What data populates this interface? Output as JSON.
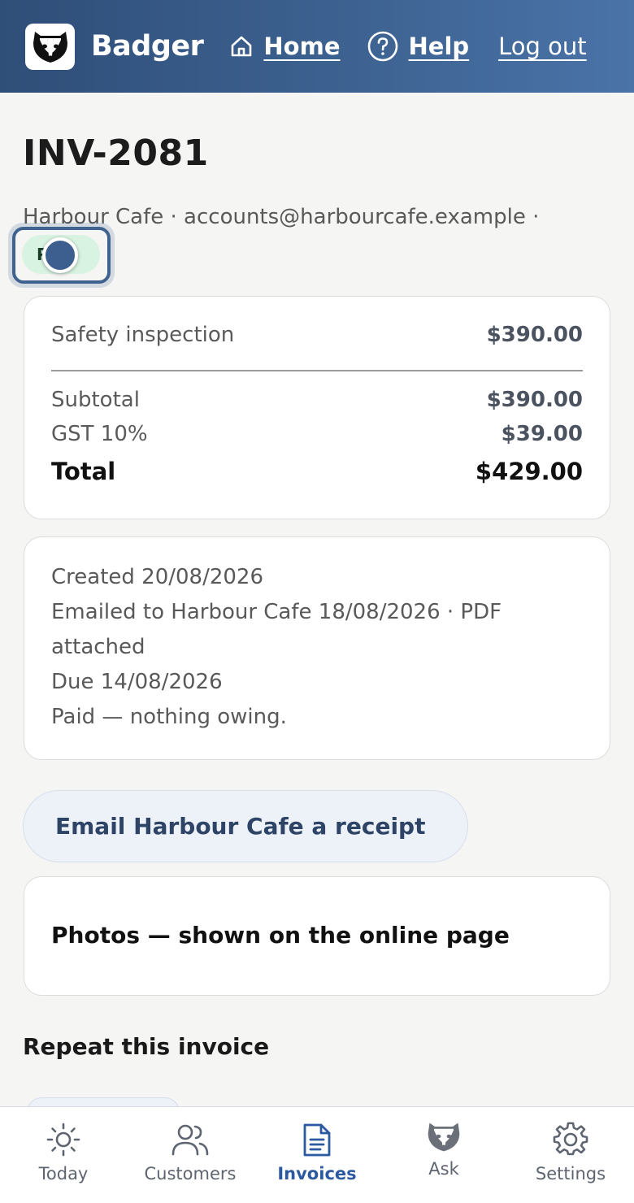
{
  "header": {
    "brand": "Badger",
    "nav": {
      "home_label": "Home",
      "help_label": "Help",
      "logout_label": "Log out"
    }
  },
  "invoice": {
    "number": "INV-2081",
    "meta_line": "Harbour Cafe · accounts@harbourcafe.example ·",
    "status_badge": "Paid"
  },
  "totals": {
    "line_items": [
      {
        "description": "Safety inspection",
        "amount": "$390.00"
      }
    ],
    "subtotal_label": "Subtotal",
    "subtotal_value": "$390.00",
    "tax_label": "GST 10%",
    "tax_value": "$39.00",
    "total_label": "Total",
    "total_value": "$429.00"
  },
  "history": {
    "created": "Created 20/08/2026",
    "emailed": "Emailed to Harbour Cafe 18/08/2026 · PDF attached",
    "due": "Due 14/08/2026",
    "paid": "Paid — nothing owing."
  },
  "actions": {
    "email_receipt_label": "Email Harbour Cafe a receipt"
  },
  "photos": {
    "title": "Photos — shown on the online page"
  },
  "repeat": {
    "heading": "Repeat this invoice"
  },
  "tabbar": {
    "items": [
      {
        "label": "Today",
        "icon": "sun-icon"
      },
      {
        "label": "Customers",
        "icon": "users-icon"
      },
      {
        "label": "Invoices",
        "icon": "document-icon",
        "active": true
      },
      {
        "label": "Ask",
        "icon": "badger-icon"
      },
      {
        "label": "Settings",
        "icon": "gear-icon"
      }
    ]
  },
  "colors": {
    "header_start": "#2f4e78",
    "header_end": "#4a73a8",
    "accent": "#2c5aa0",
    "paid_badge_bg": "#d8f3e1"
  }
}
